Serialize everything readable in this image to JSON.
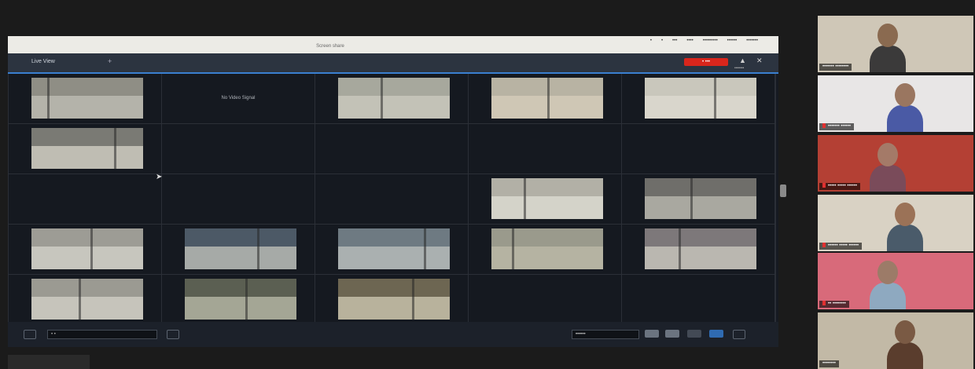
{
  "window": {
    "title": "Screen share",
    "menu": [
      "•",
      "•",
      "•••",
      "••••",
      "•••••••••",
      "••••••",
      "•••••••"
    ]
  },
  "app": {
    "tab_label": "Live View",
    "add_tab": "+",
    "record_button": "• •••",
    "fullscreen_icon": "⛶",
    "user_icon": "▲",
    "close_icon": "✕",
    "subtext": "•••••••"
  },
  "grid": {
    "no_signal_text": "No Video Signal",
    "cells": [
      {
        "type": "feed",
        "tone": "#8f8e85",
        "road": "#b4b3aa"
      },
      {
        "type": "message"
      },
      {
        "type": "feed",
        "tone": "#a7a89d",
        "road": "#c3c2b7"
      },
      {
        "type": "feed",
        "tone": "#b8b3a3",
        "road": "#cfc7b5"
      },
      {
        "type": "feed",
        "tone": "#c9c7bc",
        "road": "#d9d6cc"
      },
      {
        "type": "feed",
        "tone": "#7a7a74",
        "road": "#bfbdb3"
      },
      {
        "type": "empty"
      },
      {
        "type": "empty"
      },
      {
        "type": "empty"
      },
      {
        "type": "empty"
      },
      {
        "type": "empty"
      },
      {
        "type": "empty"
      },
      {
        "type": "empty"
      },
      {
        "type": "feed",
        "tone": "#b2b0a6",
        "road": "#d4d3c9"
      },
      {
        "type": "feed",
        "tone": "#6f6e6a",
        "road": "#a9a8a0"
      },
      {
        "type": "feed",
        "tone": "#9d9c95",
        "road": "#c7c6be"
      },
      {
        "type": "feed",
        "tone": "#4c5966",
        "road": "#a6aaa7"
      },
      {
        "type": "feed",
        "tone": "#6e7a82",
        "road": "#aab0b0"
      },
      {
        "type": "feed",
        "tone": "#9a9a8c",
        "road": "#b5b3a2"
      },
      {
        "type": "feed",
        "tone": "#7d787a",
        "road": "#bab7b0"
      },
      {
        "type": "feed",
        "tone": "#9b9a92",
        "road": "#c6c4bb"
      },
      {
        "type": "feed",
        "tone": "#5b5f52",
        "road": "#a4a695"
      },
      {
        "type": "feed",
        "tone": "#6d6652",
        "road": "#b8b29c"
      },
      {
        "type": "empty"
      },
      {
        "type": "empty"
      }
    ]
  },
  "bottom": {
    "channel_select": "• •",
    "layout_select": "••••••"
  },
  "participants": [
    {
      "name": "••••••• ••••••••",
      "bg": "#cfc7b7",
      "shirt": "#3b3a3a",
      "skin": "#8a6a50",
      "muted": false
    },
    {
      "name": "••••••• ••••••",
      "bg": "#e8e6e6",
      "shirt": "#4a5aa5",
      "skin": "#9a7660",
      "muted": true
    },
    {
      "name": "••••• ••••• ••••••",
      "bg": "#b44034",
      "shirt": "#7a4b5a",
      "skin": "#a47a68",
      "muted": true
    },
    {
      "name": "•••••• ••••• ••••••",
      "bg": "#d9d2c4",
      "shirt": "#4a5b6a",
      "skin": "#9b7257",
      "muted": true
    },
    {
      "name": "•• ••••••••",
      "bg": "#d86a7a",
      "shirt": "#8ea9c0",
      "skin": "#9c7b68",
      "muted": true
    },
    {
      "name": "••••••••",
      "bg": "#c2b9a6",
      "shirt": "#5a3d2d",
      "skin": "#7a5a44",
      "muted": false,
      "active": true
    }
  ]
}
